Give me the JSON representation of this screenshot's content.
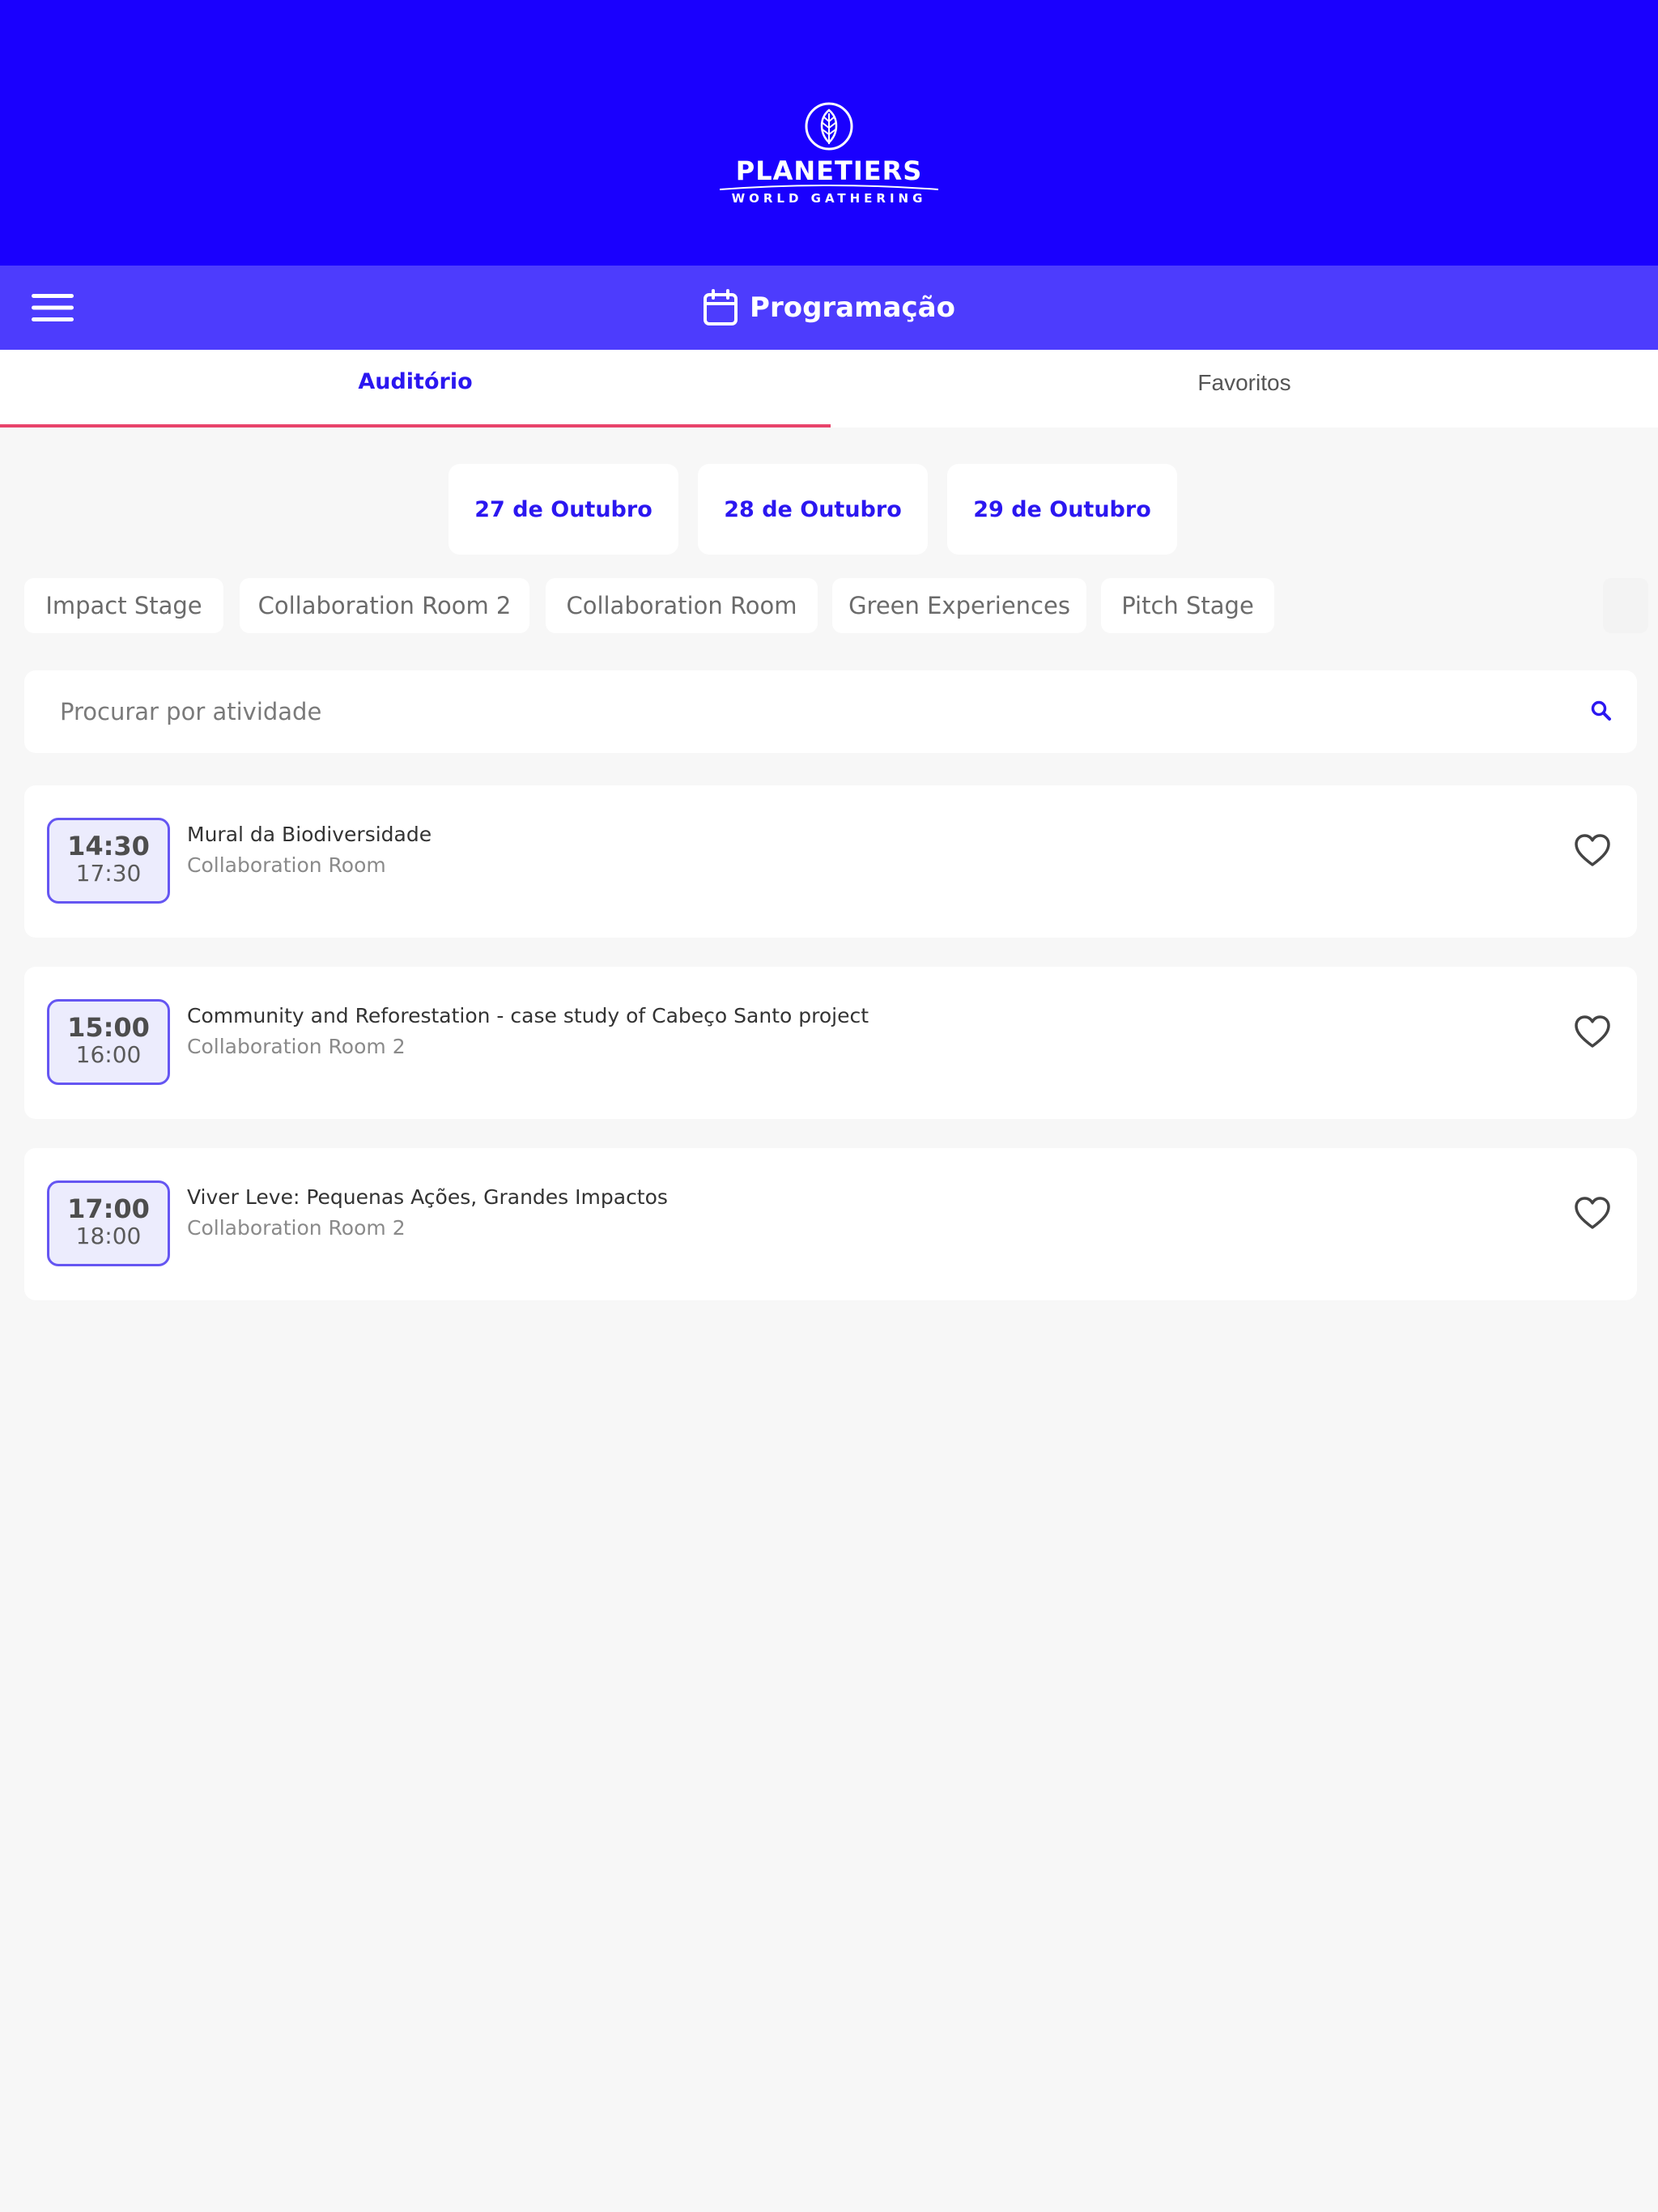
{
  "brand": {
    "name": "PLANETIERS",
    "tagline": "WORLD GATHERING",
    "colors": {
      "header": "#1a00fe",
      "toolbar": "#4d3cfd",
      "accent": "#2b17f0",
      "tab_indicator": "#e8436b"
    }
  },
  "toolbar": {
    "menu_icon": "hamburger-menu-icon",
    "title_icon": "calendar-icon",
    "title": "Programação"
  },
  "tabs": [
    {
      "label": "Auditório",
      "selected": true
    },
    {
      "label": "Favoritos",
      "selected": false
    }
  ],
  "days": [
    {
      "label": "27 de Outubro"
    },
    {
      "label": "28 de Outubro"
    },
    {
      "label": "29 de Outubro"
    }
  ],
  "rooms": [
    {
      "label": "Impact Stage"
    },
    {
      "label": "Collaboration Room 2"
    },
    {
      "label": "Collaboration Room"
    },
    {
      "label": "Green Experiences"
    },
    {
      "label": "Pitch Stage"
    }
  ],
  "search": {
    "placeholder": "Procurar por atividade",
    "value": "",
    "icon": "search-icon"
  },
  "events": [
    {
      "start": "14:30",
      "end": "17:30",
      "title": "Mural da Biodiversidade",
      "room": "Collaboration Room",
      "favorite_icon": "heart-outline-icon"
    },
    {
      "start": "15:00",
      "end": "16:00",
      "title": "Community and Reforestation - case study of Cabeço Santo project",
      "room": "Collaboration Room 2",
      "favorite_icon": "heart-outline-icon"
    },
    {
      "start": "17:00",
      "end": "18:00",
      "title": "Viver Leve: Pequenas Ações, Grandes Impactos",
      "room": "Collaboration Room 2",
      "favorite_icon": "heart-outline-icon"
    }
  ]
}
